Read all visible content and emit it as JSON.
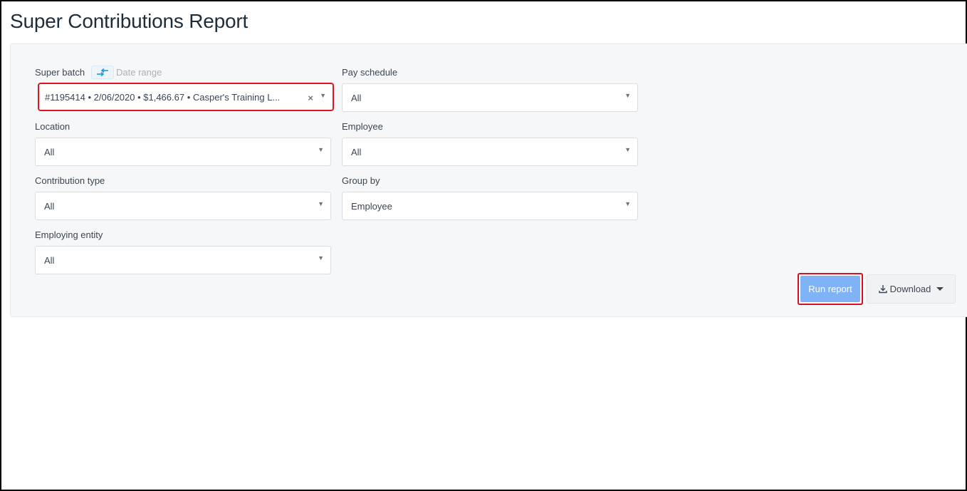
{
  "page": {
    "title": "Super Contributions Report"
  },
  "filters": {
    "super_batch": {
      "label": "Super batch",
      "toggle_icon": "swap-arrows-icon",
      "alt_link": "Date range",
      "value": "#1195414 • 2/06/2020 • $1,466.67 • Casper's Training L..."
    },
    "pay_schedule": {
      "label": "Pay schedule",
      "value": "All"
    },
    "location": {
      "label": "Location",
      "value": "All"
    },
    "employee": {
      "label": "Employee",
      "value": "All"
    },
    "contribution_type": {
      "label": "Contribution type",
      "value": "All"
    },
    "group_by": {
      "label": "Group by",
      "value": "Employee"
    },
    "employing_entity": {
      "label": "Employing entity",
      "value": "All"
    }
  },
  "actions": {
    "run_report": "Run report",
    "download": "Download"
  },
  "colors": {
    "accent_button": "#7fb3f5",
    "highlight_border": "#e0141e",
    "swap_icon": "#1a9bd7"
  }
}
